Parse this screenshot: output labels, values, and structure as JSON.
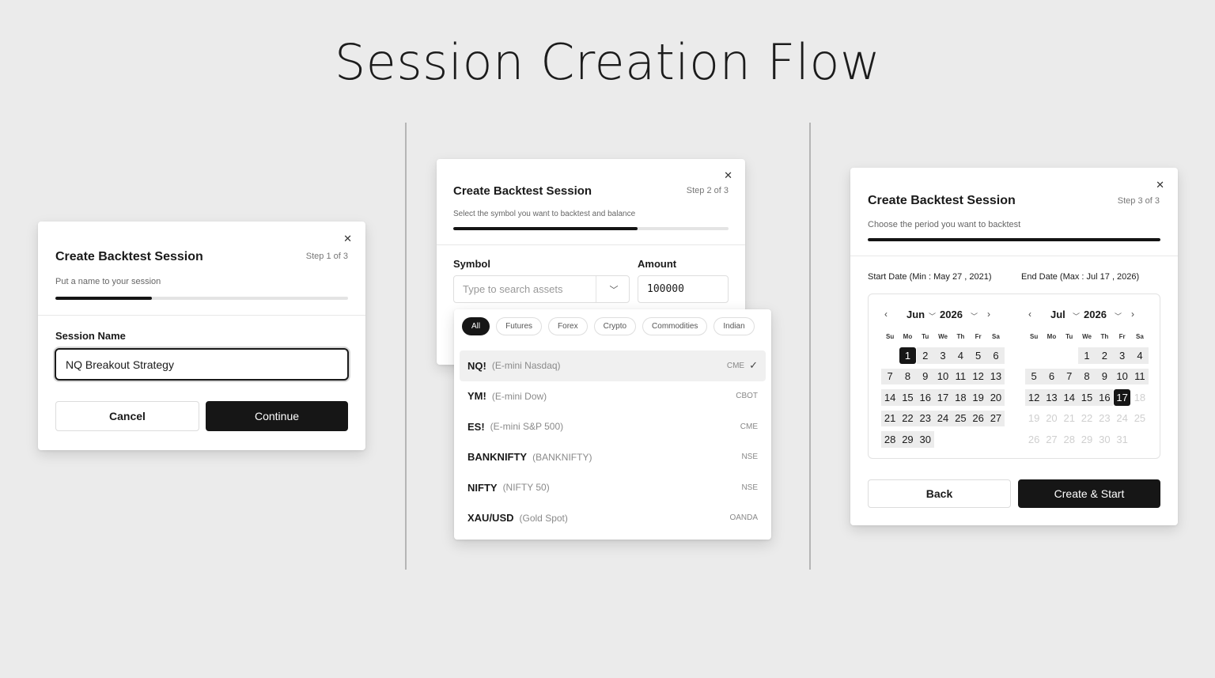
{
  "page_title": "Session Creation Flow",
  "step1": {
    "title": "Create Backtest Session",
    "step": "Step 1 of 3",
    "subtitle": "Put a name to your session",
    "progress": 0.33,
    "field_label": "Session Name",
    "field_value": "NQ Breakout Strategy",
    "cancel_label": "Cancel",
    "continue_label": "Continue"
  },
  "step2": {
    "title": "Create Backtest Session",
    "step": "Step 2 of 3",
    "subtitle": "Select the symbol you want to backtest and balance",
    "progress": 0.67,
    "symbol_label": "Symbol",
    "symbol_placeholder": "Type to search assets",
    "amount_label": "Amount",
    "amount_value": "100000",
    "categories": [
      "All",
      "Futures",
      "Forex",
      "Crypto",
      "Commodities",
      "Indian"
    ],
    "active_category": "All",
    "symbols": [
      {
        "code": "NQ!",
        "desc": "(E-mini Nasdaq)",
        "exchange": "CME",
        "selected": true
      },
      {
        "code": "YM!",
        "desc": "(E-mini Dow)",
        "exchange": "CBOT",
        "selected": false
      },
      {
        "code": "ES!",
        "desc": "(E-mini S&P 500)",
        "exchange": "CME",
        "selected": false
      },
      {
        "code": "BANKNIFTY",
        "desc": "(BANKNIFTY)",
        "exchange": "NSE",
        "selected": false
      },
      {
        "code": "NIFTY",
        "desc": "(NIFTY 50)",
        "exchange": "NSE",
        "selected": false
      },
      {
        "code": "XAU/USD",
        "desc": "(Gold Spot)",
        "exchange": "OANDA",
        "selected": false
      }
    ]
  },
  "step3": {
    "title": "Create Backtest Session",
    "step": "Step 3 of 3",
    "subtitle": "Choose the period you want to backtest",
    "progress": 1.0,
    "start_label": "Start Date (Min : May 27 , 2021)",
    "end_label": "End Date (Max : Jul 17 , 2026)",
    "weekdays": [
      "Su",
      "Mo",
      "Tu",
      "We",
      "Th",
      "Fr",
      "Sa"
    ],
    "calendars": [
      {
        "month": "Jun",
        "year": "2026",
        "first_weekday": 1,
        "days_in_month": 30,
        "selected_day": 1,
        "range_from": 1,
        "range_to": 30,
        "disabled_after": 30
      },
      {
        "month": "Jul",
        "year": "2026",
        "first_weekday": 3,
        "days_in_month": 31,
        "selected_day": 17,
        "range_from": 1,
        "range_to": 17,
        "disabled_after": 17
      }
    ],
    "back_label": "Back",
    "create_label": "Create & Start"
  },
  "icons": {
    "close": "close-icon",
    "chevron_down": "chevron-down-icon",
    "chevron_left": "chevron-left-icon",
    "chevron_right": "chevron-right-icon",
    "check": "check-icon"
  }
}
